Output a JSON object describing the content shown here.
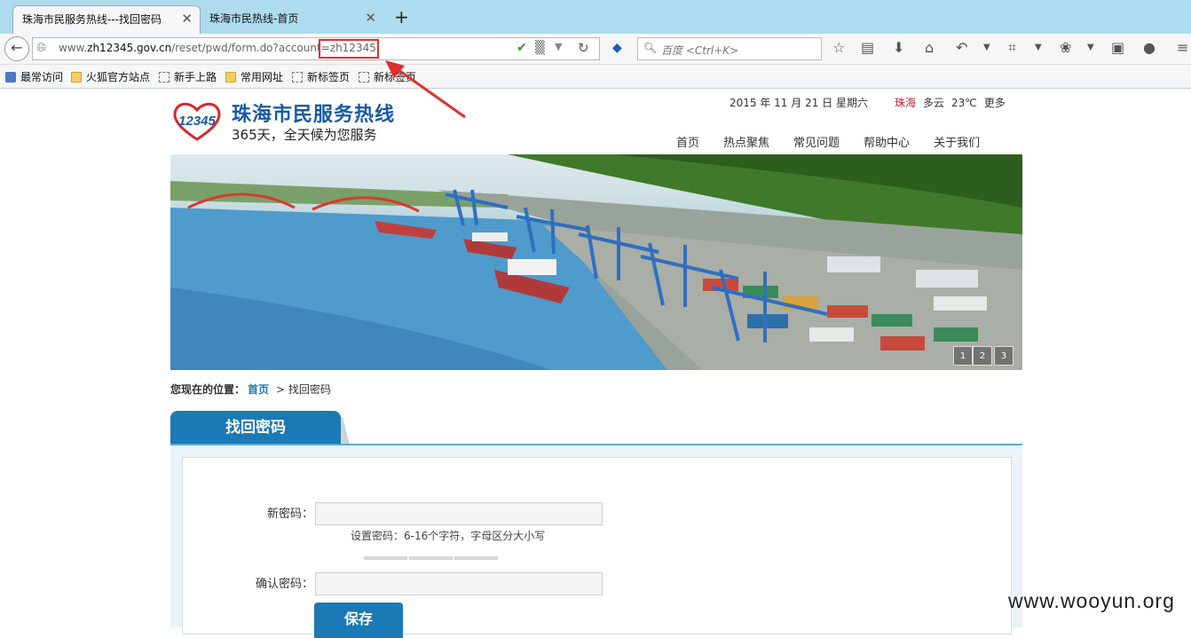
{
  "browser": {
    "tabs": [
      {
        "title": "珠海市民服务热线---找回密码",
        "active": true
      },
      {
        "title": "珠海市民热线-首页",
        "active": false
      }
    ],
    "new_tab_label": "+",
    "close_glyph": "✕",
    "url": {
      "prefix": "www.",
      "domain": "zh12345.gov.cn",
      "path": "/reset/pwd/form.do?account=",
      "account": "zh12345"
    },
    "search_placeholder": "百度 <Ctrl+K>",
    "bookmarks": [
      {
        "label": "最常访问",
        "icon": "most-visited-icon"
      },
      {
        "label": "火狐官方站点",
        "icon": "folder-icon"
      },
      {
        "label": "新手上路",
        "icon": "page-icon"
      },
      {
        "label": "常用网址",
        "icon": "folder-icon"
      },
      {
        "label": "新标签页",
        "icon": "page-icon"
      },
      {
        "label": "新标签页",
        "icon": "page-icon"
      }
    ],
    "accent_color": "#aedcee"
  },
  "header": {
    "logo_number": "12345",
    "title": "珠海市民服务热线",
    "slogan": "365天，全天候为您服务",
    "date": "2015 年 11 月 21 日 星期六",
    "weather": {
      "city": "珠海",
      "condition": "多云",
      "temp": "23℃",
      "more": "更多"
    },
    "nav": [
      "首页",
      "热点聚焦",
      "常见问题",
      "帮助中心",
      "关于我们"
    ],
    "brand_color": "#1a5aa3"
  },
  "banner": {
    "dots": [
      "1",
      "2",
      "3"
    ]
  },
  "breadcrumb": {
    "label": "您现在的位置：",
    "home": "首页",
    "current": "> 找回密码"
  },
  "section": {
    "title": "找回密码",
    "accent_color": "#1a7ab5"
  },
  "form": {
    "new_password_label": "新密码：",
    "new_password_value": "",
    "hint": "设置密码：6-16个字符，字母区分大小写",
    "confirm_label": "确认密码：",
    "confirm_value": "",
    "save_label": "保存"
  },
  "watermark": "www.wooyun.org"
}
